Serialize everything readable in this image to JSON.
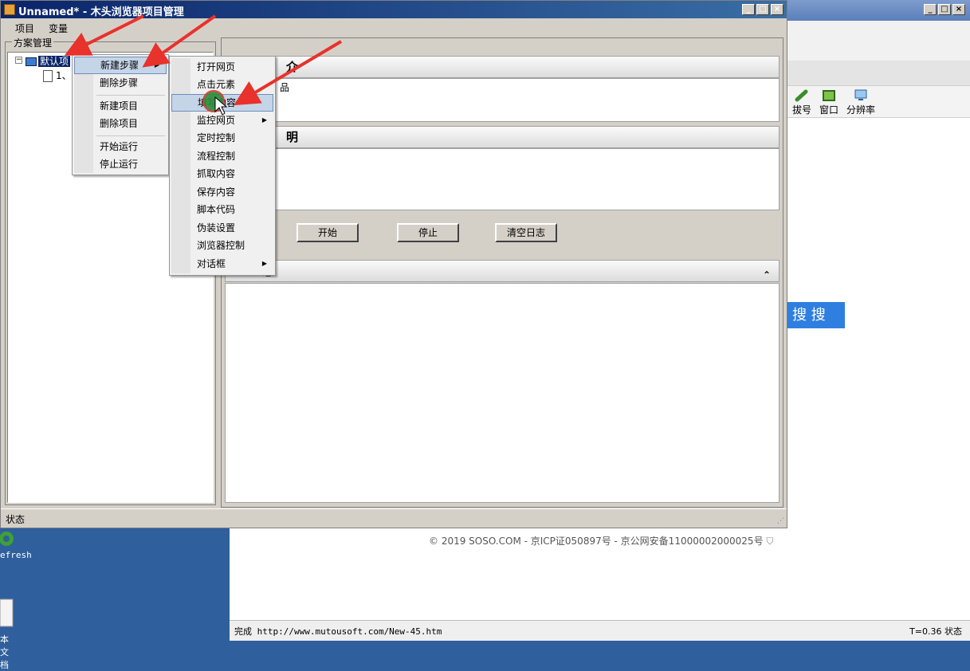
{
  "app": {
    "title": "Unnamed* - 木头浏览器项目管理",
    "menu": [
      "项目",
      "变量"
    ],
    "tree_group_label": "方案管理",
    "tree": {
      "root_label": "默认项",
      "child_label": "1、"
    },
    "section1_title": "介",
    "section1_text": "品",
    "section2_title": "明",
    "buttons": {
      "start": "开始",
      "stop": "停止",
      "clear_log": "清空日志"
    },
    "log_title": "志",
    "status": "状态"
  },
  "context_menu": {
    "items": [
      "新建步骤",
      "删除步骤",
      "新建项目",
      "删除项目",
      "开始运行",
      "停止运行"
    ],
    "highlighted_index": 0
  },
  "submenu": {
    "items": [
      "打开网页",
      "点击元素",
      "填写内容",
      "监控网页",
      "定时控制",
      "流程控制",
      "抓取内容",
      "保存内容",
      "脚本代码",
      "伪装设置",
      "浏览器控制",
      "对话框"
    ],
    "highlighted_index": 2,
    "has_submenu": [
      "监控网页",
      "对话框"
    ]
  },
  "browser": {
    "toolbar": [
      "拔号",
      "窗口",
      "分辨率"
    ],
    "search_button": "搜 搜",
    "footer": "© 2019 SOSO.COM - 京ICP证050897号 - 京公网安备11000002000025号",
    "status_left": "完成 http://www.mutousoft.com/New-45.htm",
    "status_right": "T=0.36 状态"
  },
  "desktop": {
    "icons": [
      "efresh",
      "本文档"
    ]
  },
  "colors": {
    "title_active": "#0a246a",
    "annotation_arrow": "#e8322b",
    "search_button": "#2f7fe0",
    "cursor_ring": "#2e8b3a"
  }
}
